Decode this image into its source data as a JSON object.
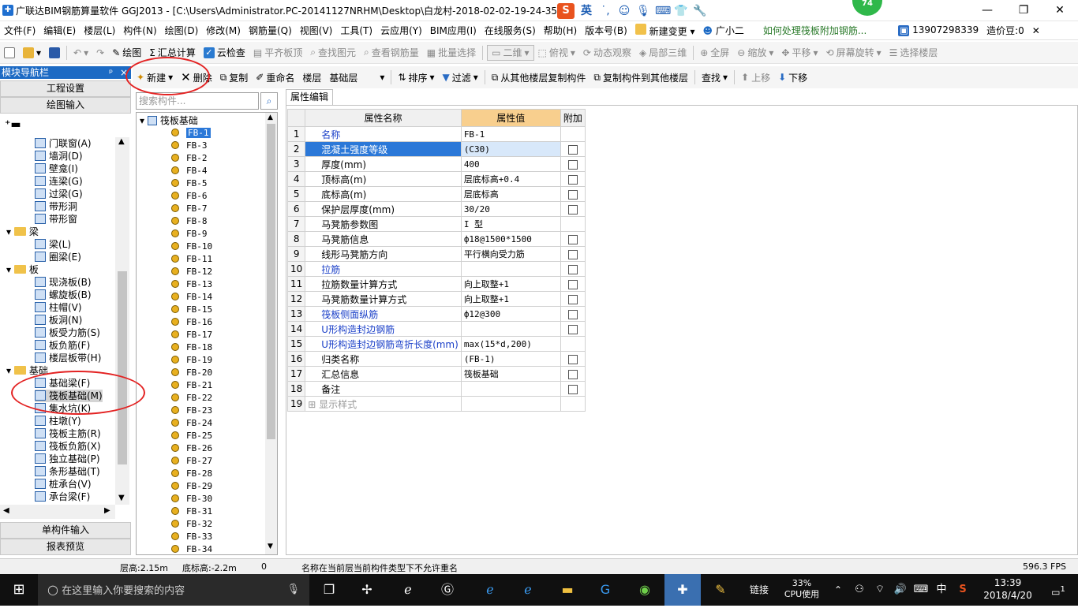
{
  "window": {
    "title": "广联达BIM钢筋算量软件 GGJ2013 - [C:\\Users\\Administrator.PC-20141127NRHM\\Desktop\\白龙村-2018-02-02-19-24-35",
    "badge": "74",
    "ime": {
      "logo": "S",
      "lang": "英"
    }
  },
  "menu": {
    "items": [
      "文件(F)",
      "编辑(E)",
      "楼层(L)",
      "构件(N)",
      "绘图(D)",
      "修改(M)",
      "钢筋量(Q)",
      "视图(V)",
      "工具(T)",
      "云应用(Y)",
      "BIM应用(I)",
      "在线服务(S)",
      "帮助(H)",
      "版本号(B)"
    ],
    "new_change": "新建变更",
    "assistant": "广小二",
    "hint_link": "如何处理筏板附加钢筋...",
    "phone": "13907298339",
    "coins": "造价豆:0"
  },
  "toolbar1": {
    "draw": "绘图",
    "summary": "汇总计算",
    "cloud_check": "云检查",
    "level_top": "平齐板顶",
    "find_element": "查找图元",
    "view_rebar": "查看钢筋量",
    "batch_select": "批量选择",
    "view_mode": "二维",
    "top_view": "俯视",
    "dynamic_view": "动态观察",
    "local_3d": "局部三维",
    "fullscreen": "全屏",
    "zoom": "缩放",
    "pan": "平移",
    "rotate": "屏幕旋转",
    "select_floor": "选择楼层"
  },
  "navpanel": {
    "header": "模块导航栏",
    "pin": "ᵖ",
    "close": "×",
    "project_settings": "工程设置",
    "drawing_input": "绘图输入",
    "single_input": "单构件输入",
    "report_preview": "报表预览",
    "tree": [
      {
        "label": "门联窗(A)",
        "indent": 2
      },
      {
        "label": "墙洞(D)",
        "indent": 2
      },
      {
        "label": "壁龛(I)",
        "indent": 2
      },
      {
        "label": "连梁(G)",
        "indent": 2
      },
      {
        "label": "过梁(G)",
        "indent": 2
      },
      {
        "label": "带形洞",
        "indent": 2
      },
      {
        "label": "带形窗",
        "indent": 2
      },
      {
        "label": "梁",
        "indent": 1,
        "folder": true
      },
      {
        "label": "梁(L)",
        "indent": 2
      },
      {
        "label": "圈梁(E)",
        "indent": 2
      },
      {
        "label": "板",
        "indent": 1,
        "folder": true
      },
      {
        "label": "现浇板(B)",
        "indent": 2
      },
      {
        "label": "螺旋板(B)",
        "indent": 2
      },
      {
        "label": "柱帽(V)",
        "indent": 2
      },
      {
        "label": "板洞(N)",
        "indent": 2
      },
      {
        "label": "板受力筋(S)",
        "indent": 2
      },
      {
        "label": "板负筋(F)",
        "indent": 2
      },
      {
        "label": "楼层板带(H)",
        "indent": 2
      },
      {
        "label": "基础",
        "indent": 1,
        "folder": true
      },
      {
        "label": "基础梁(F)",
        "indent": 2
      },
      {
        "label": "筏板基础(M)",
        "indent": 2,
        "selected": true
      },
      {
        "label": "集水坑(K)",
        "indent": 2
      },
      {
        "label": "柱墩(Y)",
        "indent": 2
      },
      {
        "label": "筏板主筋(R)",
        "indent": 2
      },
      {
        "label": "筏板负筋(X)",
        "indent": 2
      },
      {
        "label": "独立基础(P)",
        "indent": 2
      },
      {
        "label": "条形基础(T)",
        "indent": 2
      },
      {
        "label": "桩承台(V)",
        "indent": 2
      },
      {
        "label": "承台梁(F)",
        "indent": 2
      }
    ]
  },
  "toolbar2": {
    "new": "新建",
    "delete": "删除",
    "copy": "复制",
    "rename": "重命名",
    "floor_label": "楼层",
    "floor_value": "基础层",
    "sort": "排序",
    "filter": "过滤",
    "copy_from_floor": "从其他楼层复制构件",
    "copy_to_floor": "复制构件到其他楼层",
    "find": "查找",
    "move_up": "上移",
    "move_down": "下移"
  },
  "components": {
    "search_placeholder": "搜索构件...",
    "root": "筏板基础",
    "items": [
      "FB-1",
      "FB-3",
      "FB-2",
      "FB-4",
      "FB-5",
      "FB-6",
      "FB-7",
      "FB-8",
      "FB-9",
      "FB-10",
      "FB-11",
      "FB-12",
      "FB-13",
      "FB-14",
      "FB-15",
      "FB-16",
      "FB-17",
      "FB-18",
      "FB-19",
      "FB-20",
      "FB-21",
      "FB-22",
      "FB-23",
      "FB-24",
      "FB-25",
      "FB-26",
      "FB-27",
      "FB-28",
      "FB-29",
      "FB-30",
      "FB-31",
      "FB-32",
      "FB-33",
      "FB-34"
    ]
  },
  "properties": {
    "tab": "属性编辑",
    "col_name": "属性名称",
    "col_value": "属性值",
    "col_extra": "附加",
    "rows": [
      {
        "n": "1",
        "name": "名称",
        "value": "FB-1",
        "blue": true,
        "check": false
      },
      {
        "n": "2",
        "name": "混凝土强度等级",
        "value": "(C30)",
        "check": true,
        "sel": true
      },
      {
        "n": "3",
        "name": "厚度(mm)",
        "value": "400",
        "check": true
      },
      {
        "n": "4",
        "name": "顶标高(m)",
        "value": "层底标高+0.4",
        "check": true
      },
      {
        "n": "5",
        "name": "底标高(m)",
        "value": "层底标高",
        "check": true
      },
      {
        "n": "6",
        "name": "保护层厚度(mm)",
        "value": "30/20",
        "check": true
      },
      {
        "n": "7",
        "name": "马凳筋参数图",
        "value": "I 型",
        "check": false
      },
      {
        "n": "8",
        "name": "马凳筋信息",
        "value": "ф18@1500*1500",
        "check": true
      },
      {
        "n": "9",
        "name": "线形马凳筋方向",
        "value": "平行横向受力筋",
        "check": true
      },
      {
        "n": "10",
        "name": "拉筋",
        "value": "",
        "blue": true,
        "check": true
      },
      {
        "n": "11",
        "name": "拉筋数量计算方式",
        "value": "向上取整+1",
        "check": true
      },
      {
        "n": "12",
        "name": "马凳筋数量计算方式",
        "value": "向上取整+1",
        "check": true
      },
      {
        "n": "13",
        "name": "筏板侧面纵筋",
        "value": "ф12@300",
        "blue": true,
        "check": true
      },
      {
        "n": "14",
        "name": "U形构造封边钢筋",
        "value": "",
        "blue": true,
        "check": true
      },
      {
        "n": "15",
        "name": "U形构造封边钢筋弯折长度(mm)",
        "value": "max(15*d,200)",
        "blue": true,
        "check": false
      },
      {
        "n": "16",
        "name": "归类名称",
        "value": "(FB-1)",
        "check": true
      },
      {
        "n": "17",
        "name": "汇总信息",
        "value": "筏板基础",
        "check": true
      },
      {
        "n": "18",
        "name": "备注",
        "value": "",
        "check": true
      },
      {
        "n": "19",
        "name": "显示样式",
        "value": "",
        "expand": true,
        "gray": true,
        "check": false
      }
    ]
  },
  "status": {
    "floor_height": "层高:2.15m",
    "bottom_elev": "底标高:-2.2m",
    "zero": "0",
    "message": "名称在当前层当前构件类型下不允许重名",
    "fps": "596.3 FPS"
  },
  "taskbar": {
    "search_placeholder": "在这里输入你要搜索的内容",
    "link_label": "链接",
    "cpu_pct": "33%",
    "cpu_label": "CPU使用",
    "ime": "中",
    "time": "13:39",
    "date": "2018/4/20",
    "notif": "1"
  },
  "colors": {
    "accent": "#1c6ac4",
    "selected_row": "#2b78d8",
    "header_value": "#f8cf8e",
    "annotation": "#e32222"
  }
}
